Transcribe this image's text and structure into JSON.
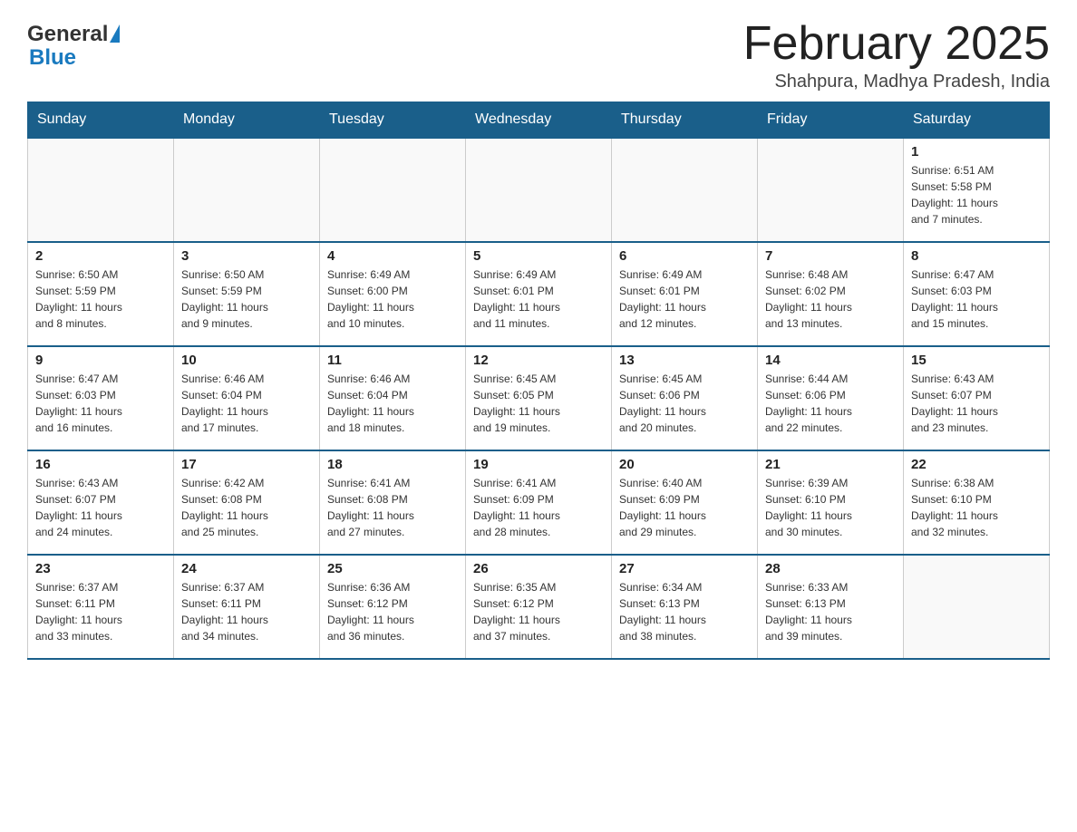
{
  "logo": {
    "general": "General",
    "blue": "Blue"
  },
  "title": "February 2025",
  "subtitle": "Shahpura, Madhya Pradesh, India",
  "days_of_week": [
    "Sunday",
    "Monday",
    "Tuesday",
    "Wednesday",
    "Thursday",
    "Friday",
    "Saturday"
  ],
  "weeks": [
    [
      {
        "day": "",
        "info": ""
      },
      {
        "day": "",
        "info": ""
      },
      {
        "day": "",
        "info": ""
      },
      {
        "day": "",
        "info": ""
      },
      {
        "day": "",
        "info": ""
      },
      {
        "day": "",
        "info": ""
      },
      {
        "day": "1",
        "info": "Sunrise: 6:51 AM\nSunset: 5:58 PM\nDaylight: 11 hours\nand 7 minutes."
      }
    ],
    [
      {
        "day": "2",
        "info": "Sunrise: 6:50 AM\nSunset: 5:59 PM\nDaylight: 11 hours\nand 8 minutes."
      },
      {
        "day": "3",
        "info": "Sunrise: 6:50 AM\nSunset: 5:59 PM\nDaylight: 11 hours\nand 9 minutes."
      },
      {
        "day": "4",
        "info": "Sunrise: 6:49 AM\nSunset: 6:00 PM\nDaylight: 11 hours\nand 10 minutes."
      },
      {
        "day": "5",
        "info": "Sunrise: 6:49 AM\nSunset: 6:01 PM\nDaylight: 11 hours\nand 11 minutes."
      },
      {
        "day": "6",
        "info": "Sunrise: 6:49 AM\nSunset: 6:01 PM\nDaylight: 11 hours\nand 12 minutes."
      },
      {
        "day": "7",
        "info": "Sunrise: 6:48 AM\nSunset: 6:02 PM\nDaylight: 11 hours\nand 13 minutes."
      },
      {
        "day": "8",
        "info": "Sunrise: 6:47 AM\nSunset: 6:03 PM\nDaylight: 11 hours\nand 15 minutes."
      }
    ],
    [
      {
        "day": "9",
        "info": "Sunrise: 6:47 AM\nSunset: 6:03 PM\nDaylight: 11 hours\nand 16 minutes."
      },
      {
        "day": "10",
        "info": "Sunrise: 6:46 AM\nSunset: 6:04 PM\nDaylight: 11 hours\nand 17 minutes."
      },
      {
        "day": "11",
        "info": "Sunrise: 6:46 AM\nSunset: 6:04 PM\nDaylight: 11 hours\nand 18 minutes."
      },
      {
        "day": "12",
        "info": "Sunrise: 6:45 AM\nSunset: 6:05 PM\nDaylight: 11 hours\nand 19 minutes."
      },
      {
        "day": "13",
        "info": "Sunrise: 6:45 AM\nSunset: 6:06 PM\nDaylight: 11 hours\nand 20 minutes."
      },
      {
        "day": "14",
        "info": "Sunrise: 6:44 AM\nSunset: 6:06 PM\nDaylight: 11 hours\nand 22 minutes."
      },
      {
        "day": "15",
        "info": "Sunrise: 6:43 AM\nSunset: 6:07 PM\nDaylight: 11 hours\nand 23 minutes."
      }
    ],
    [
      {
        "day": "16",
        "info": "Sunrise: 6:43 AM\nSunset: 6:07 PM\nDaylight: 11 hours\nand 24 minutes."
      },
      {
        "day": "17",
        "info": "Sunrise: 6:42 AM\nSunset: 6:08 PM\nDaylight: 11 hours\nand 25 minutes."
      },
      {
        "day": "18",
        "info": "Sunrise: 6:41 AM\nSunset: 6:08 PM\nDaylight: 11 hours\nand 27 minutes."
      },
      {
        "day": "19",
        "info": "Sunrise: 6:41 AM\nSunset: 6:09 PM\nDaylight: 11 hours\nand 28 minutes."
      },
      {
        "day": "20",
        "info": "Sunrise: 6:40 AM\nSunset: 6:09 PM\nDaylight: 11 hours\nand 29 minutes."
      },
      {
        "day": "21",
        "info": "Sunrise: 6:39 AM\nSunset: 6:10 PM\nDaylight: 11 hours\nand 30 minutes."
      },
      {
        "day": "22",
        "info": "Sunrise: 6:38 AM\nSunset: 6:10 PM\nDaylight: 11 hours\nand 32 minutes."
      }
    ],
    [
      {
        "day": "23",
        "info": "Sunrise: 6:37 AM\nSunset: 6:11 PM\nDaylight: 11 hours\nand 33 minutes."
      },
      {
        "day": "24",
        "info": "Sunrise: 6:37 AM\nSunset: 6:11 PM\nDaylight: 11 hours\nand 34 minutes."
      },
      {
        "day": "25",
        "info": "Sunrise: 6:36 AM\nSunset: 6:12 PM\nDaylight: 11 hours\nand 36 minutes."
      },
      {
        "day": "26",
        "info": "Sunrise: 6:35 AM\nSunset: 6:12 PM\nDaylight: 11 hours\nand 37 minutes."
      },
      {
        "day": "27",
        "info": "Sunrise: 6:34 AM\nSunset: 6:13 PM\nDaylight: 11 hours\nand 38 minutes."
      },
      {
        "day": "28",
        "info": "Sunrise: 6:33 AM\nSunset: 6:13 PM\nDaylight: 11 hours\nand 39 minutes."
      },
      {
        "day": "",
        "info": ""
      }
    ]
  ]
}
